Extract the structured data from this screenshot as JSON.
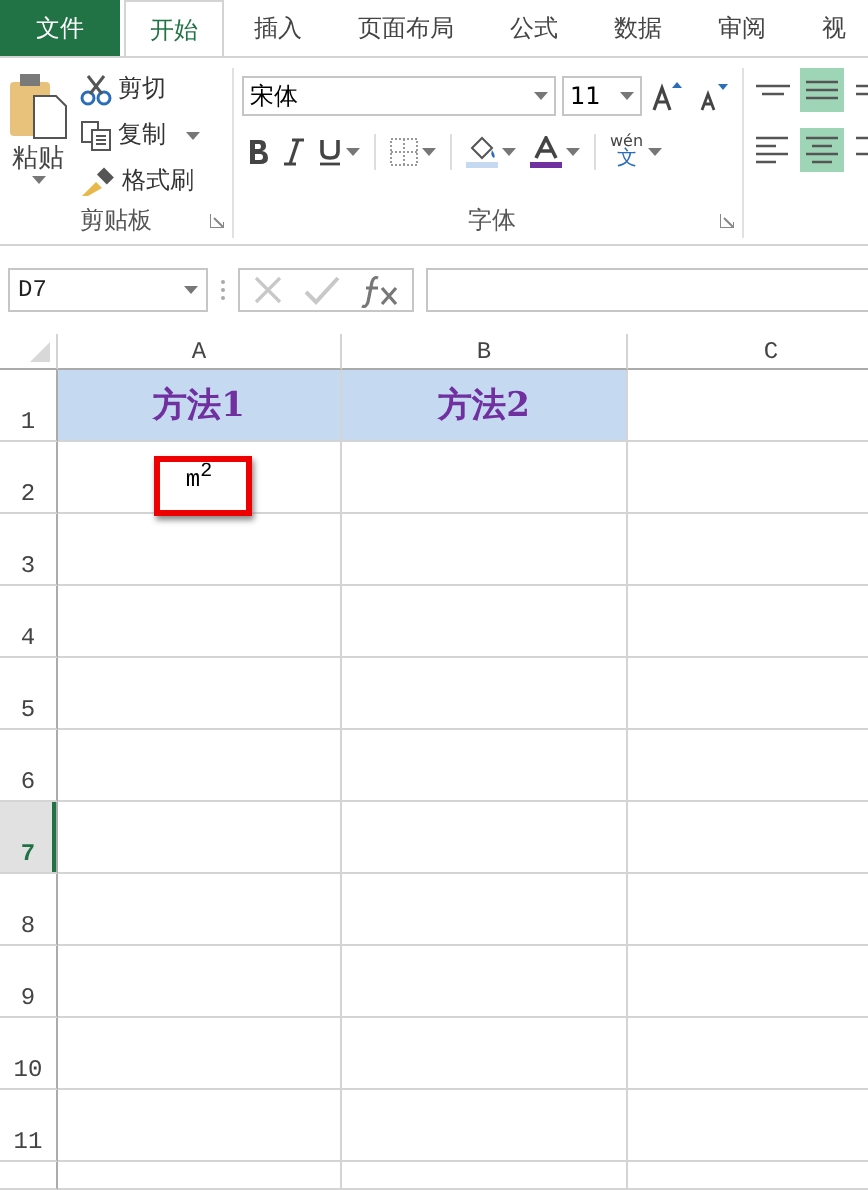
{
  "tabs": [
    {
      "label": "文件",
      "kind": "file",
      "selected": false
    },
    {
      "label": "开始",
      "kind": "tab",
      "selected": true
    },
    {
      "label": "插入",
      "kind": "tab",
      "selected": false
    },
    {
      "label": "页面布局",
      "kind": "tab",
      "selected": false
    },
    {
      "label": "公式",
      "kind": "tab",
      "selected": false
    },
    {
      "label": "数据",
      "kind": "tab",
      "selected": false
    },
    {
      "label": "审阅",
      "kind": "tab",
      "selected": false
    },
    {
      "label": "视",
      "kind": "tab",
      "selected": false
    }
  ],
  "clipboard": {
    "paste": "粘贴",
    "cut": "剪切",
    "copy": "复制",
    "format_painter": "格式刷",
    "label": "剪贴板"
  },
  "font": {
    "name": "宋体",
    "size": "11",
    "label": "字体",
    "phonetic_top": "wén",
    "phonetic_bottom": "文"
  },
  "alignment": [
    {
      "kind": "top",
      "selected": false
    },
    {
      "kind": "middle",
      "selected": true
    },
    {
      "kind": "bottom",
      "selected": false
    },
    {
      "kind": "left",
      "selected": false
    },
    {
      "kind": "center",
      "selected": true
    },
    {
      "kind": "right",
      "selected": false
    }
  ],
  "formula_bar": {
    "name_box": "D7"
  },
  "grid": {
    "columns": [
      {
        "label": "A"
      },
      {
        "label": "B"
      },
      {
        "label": "C"
      }
    ],
    "rows": [
      {
        "label": "1",
        "selected": false,
        "cells": [
          {
            "text": "方法1",
            "filled": true,
            "highlighted": false
          },
          {
            "text": "方法2",
            "filled": true,
            "highlighted": false
          },
          {
            "filled": false,
            "highlighted": false
          }
        ]
      },
      {
        "label": "2",
        "selected": false,
        "cells": [
          {
            "text": "m$^{2}$",
            "filled": false,
            "highlighted": true
          }
        ]
      },
      {
        "label": "3",
        "selected": false
      },
      {
        "label": "4",
        "selected": false
      },
      {
        "label": "5",
        "selected": false
      },
      {
        "label": "6",
        "selected": false
      },
      {
        "label": "7",
        "selected": true
      },
      {
        "label": "8",
        "selected": false
      },
      {
        "label": "9",
        "selected": false
      },
      {
        "label": "10",
        "selected": false
      },
      {
        "label": "11",
        "selected": false
      }
    ]
  }
}
